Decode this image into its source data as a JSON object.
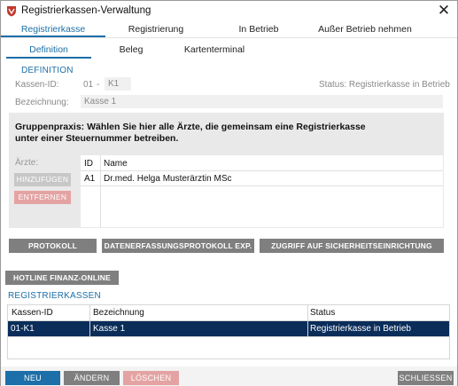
{
  "window": {
    "title": "Registrierkassen-Verwaltung",
    "close_symbol": "✕"
  },
  "tabs": [
    {
      "label": "Registrierkasse",
      "active": true
    },
    {
      "label": "Registrierung",
      "active": false
    },
    {
      "label": "In Betrieb",
      "active": false
    },
    {
      "label": "Außer Betrieb nehmen",
      "active": false
    }
  ],
  "subtabs": [
    {
      "label": "Definition",
      "active": true
    },
    {
      "label": "Beleg",
      "active": false
    },
    {
      "label": "Kartenterminal",
      "active": false
    }
  ],
  "definition": {
    "section_title": "DEFINITION",
    "kassen_id_label": "Kassen-ID:",
    "kassen_id_prefix": "01",
    "kassen_id_sep": "-",
    "kassen_id_value": "K1",
    "status_text": "Status: Registrierkasse in Betrieb",
    "bezeichnung_label": "Bezeichnung:",
    "bezeichnung_value": "Kasse 1"
  },
  "group_practice": {
    "text": "Gruppenpraxis: Wählen Sie hier alle Ärzte, die gemeinsam eine Registrierkasse unter einer Steuernummer betreiben.",
    "aerzte_label": "Ärzte:",
    "add_button": "HINZUFÜGEN",
    "remove_button": "ENTFERNEN",
    "table": {
      "headers": [
        "ID",
        "Name"
      ],
      "rows": [
        [
          "A1",
          "Dr.med. Helga Musterärztin MSc"
        ]
      ]
    }
  },
  "action_buttons": {
    "protokoll": "PROTOKOLL ANZEIGEN",
    "datenerfassung": "DATENERFASSUNGSPROTOKOLL EXP.",
    "zugriff": "ZUGRIFF AUF SICHERHEITSEINRICHTUNG ABST."
  },
  "hotline_button": "HOTLINE FINANZ-ONLINE",
  "registrierkassen": {
    "section_title": "REGISTRIERKASSEN",
    "headers": [
      "Kassen-ID",
      "Bezeichnung",
      "Status"
    ],
    "rows": [
      [
        "01-K1",
        "Kasse 1",
        "Registrierkasse in Betrieb"
      ]
    ]
  },
  "footer": {
    "neu": "NEU",
    "aendern": "ÄNDERN",
    "loeschen": "LÖSCHEN",
    "schliessen": "SCHLIESSEN"
  },
  "colors": {
    "accent": "#1c6fa8",
    "selected_row": "#0a2d5a",
    "primary_button": "#1c6fa8",
    "disabled_delete": "#e4a3a3"
  }
}
